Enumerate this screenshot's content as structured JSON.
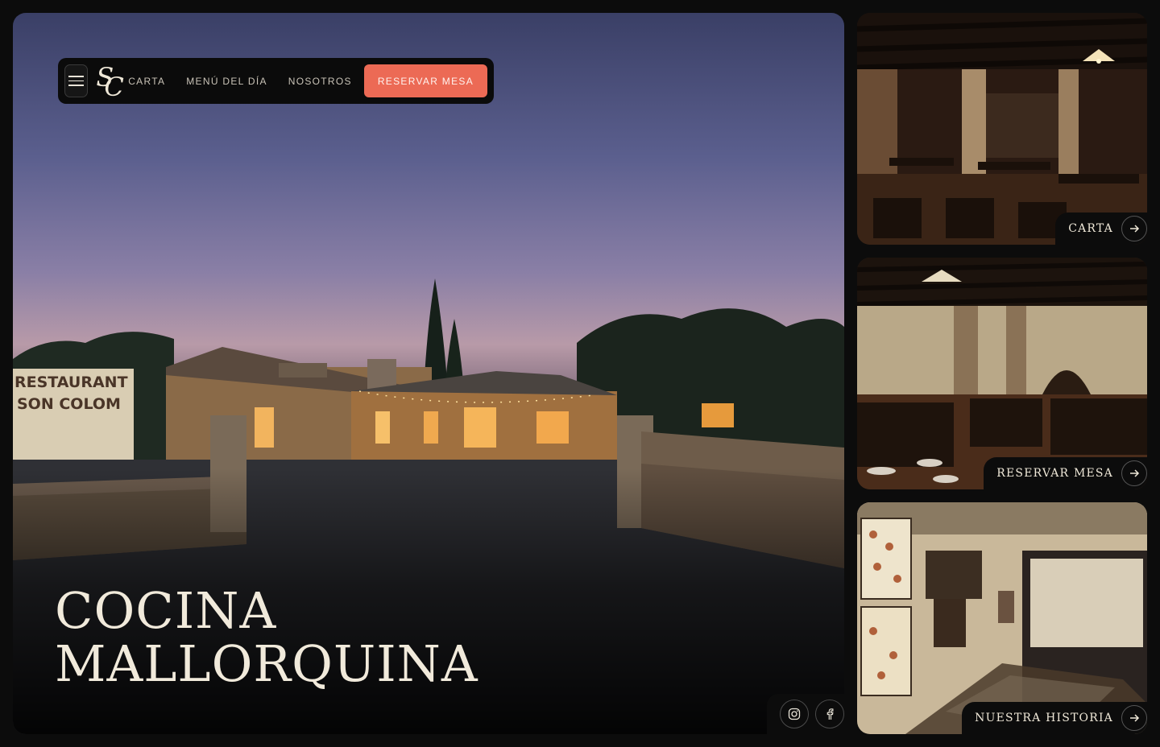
{
  "nav": {
    "links": [
      "CARTA",
      "MENÚ DEL DÍA",
      "NOSOTROS"
    ],
    "reserve_label": "RESERVAR MESA",
    "logo_text": "SC"
  },
  "hero": {
    "title_line1": "COCINA",
    "title_line2": "MALLORQUINA",
    "sign_line1": "RESTAURANT",
    "sign_line2": "SON COLOM"
  },
  "cards": [
    {
      "label": "CARTA"
    },
    {
      "label": "RESERVAR MESA"
    },
    {
      "label": "NUESTRA HISTORIA"
    }
  ],
  "socials": [
    "instagram-icon",
    "facebook-icon"
  ],
  "colors": {
    "accent": "#ec6a55",
    "background": "#0c0c0c",
    "text_light": "#f1eadb"
  }
}
